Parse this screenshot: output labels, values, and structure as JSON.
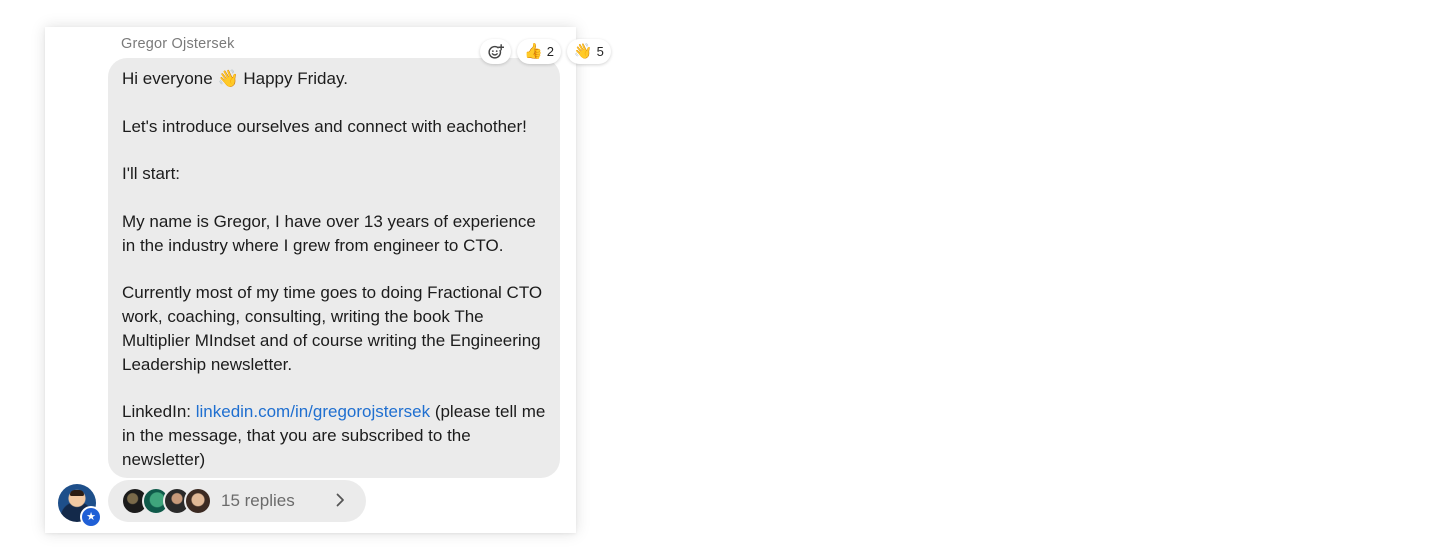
{
  "message": {
    "sender": "Gregor Ojstersek",
    "greeting_before": "Hi everyone",
    "greeting_emoji": "👋",
    "greeting_after": "Happy Friday.",
    "line_intro": "Let's introduce ourselves and connect with eachother!",
    "line_start": "I'll start:",
    "line_bio": "My name is Gregor, I have over 13 years of experience in the industry where I grew from engineer to CTO.",
    "line_work": "Currently most of my time goes to doing Fractional CTO work, coaching, consulting, writing the book The Multiplier MIndset and of course writing the Engineering Leadership newsletter.",
    "linkedin_label": "LinkedIn:",
    "linkedin_link": "linkedin.com/in/gregorojstersek",
    "linkedin_note": "(please tell me in the message, that you are subscribed to the newsletter)"
  },
  "reactions": [
    {
      "emoji": "👍",
      "count": "2"
    },
    {
      "emoji": "👋",
      "count": "5"
    }
  ],
  "thread": {
    "replies_label": "15 replies"
  },
  "colors": {
    "bubble": "#ebebeb",
    "link": "#1f6fd0",
    "badge": "#1f5fd6"
  }
}
